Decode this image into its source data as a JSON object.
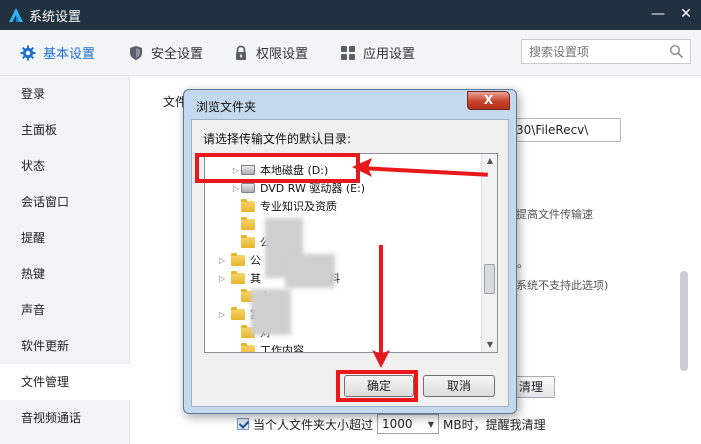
{
  "window": {
    "title": "系统设置",
    "minimize_glyph": "—",
    "close_glyph": "✕"
  },
  "tabs": [
    {
      "label": "基本设置",
      "icon": "gear-icon"
    },
    {
      "label": "安全设置",
      "icon": "shield-icon"
    },
    {
      "label": "权限设置",
      "icon": "lock-icon"
    },
    {
      "label": "应用设置",
      "icon": "apps-icon"
    }
  ],
  "search": {
    "placeholder": "搜索设置项"
  },
  "sidebar": {
    "items": [
      "登录",
      "主面板",
      "状态",
      "会话窗口",
      "提醒",
      "热键",
      "声音",
      "软件更新",
      "文件管理",
      "音视频通话"
    ],
    "active_index": 8
  },
  "main": {
    "label_prefix": "文件",
    "path_value": "30\\FileRecv\\",
    "hint_speed": "提高文件传输速",
    "hint_unsupported": "系统不支持此选项)",
    "hint_period": "。",
    "clear_label": "清理",
    "bottom_text_prefix": "当个人文件夹大小超过",
    "bottom_size": "1000",
    "bottom_text_suffix": "MB时，提醒我清理"
  },
  "dialog": {
    "title": "浏览文件夹",
    "close_label": "X",
    "prompt": "请选择传输文件的默认目录:",
    "tree": {
      "local_disk": "本地磁盘 (D:)",
      "dvd_drive": "DVD RW 驱动器 (E:)",
      "folder_1": "专业知识及资质",
      "folder_2_prefix": "公",
      "folder_3_prefix": "公",
      "folder_4_prefix": "其",
      "folder_4_suffix": "户资料",
      "folder_5_prefix": "合",
      "folder_6_prefix": "富",
      "folder_7_prefix": "对",
      "folder_8": "工作内容"
    },
    "ok_label": "确定",
    "cancel_label": "取消"
  },
  "colors": {
    "accent": "#1e6fd0",
    "annotation_red": "#e8181c",
    "titlebar": "#22313f"
  }
}
